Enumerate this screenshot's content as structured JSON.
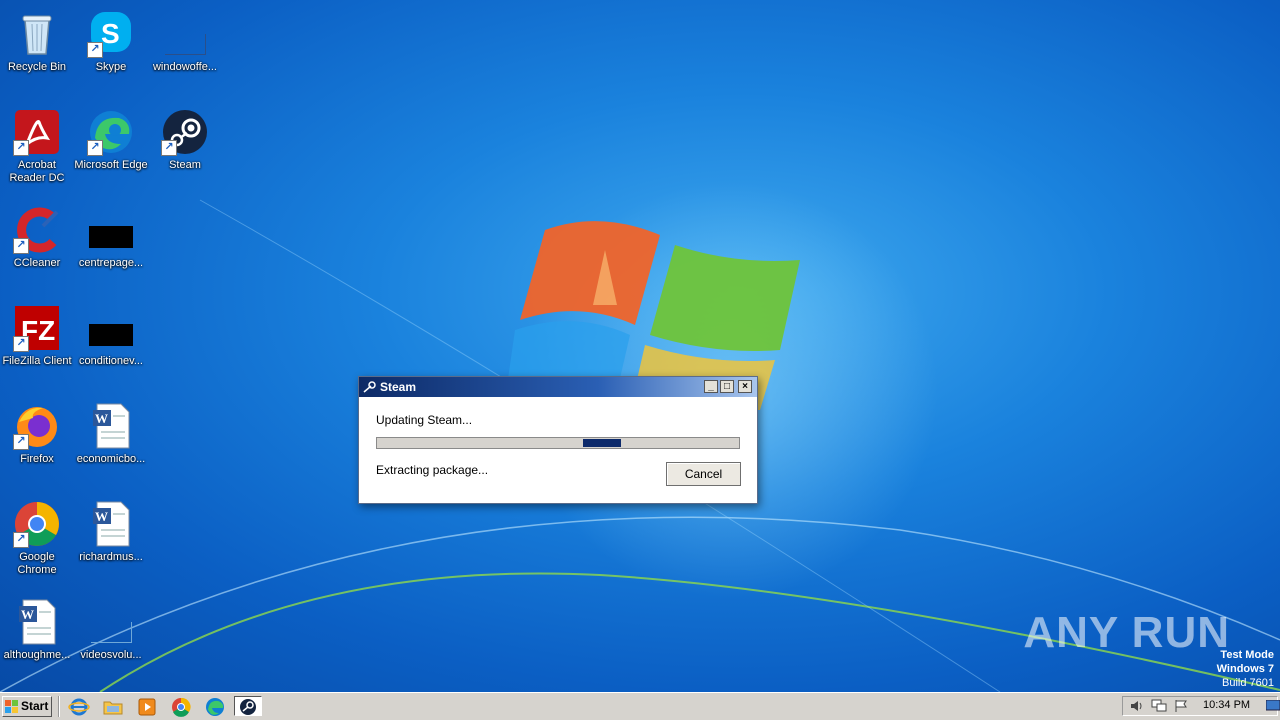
{
  "desktop": {
    "icons": [
      {
        "label": "Recycle Bin"
      },
      {
        "label": "Skype"
      },
      {
        "label": "windowoffe..."
      },
      {
        "label": "Acrobat Reader DC"
      },
      {
        "label": "Microsoft Edge"
      },
      {
        "label": "Steam"
      },
      {
        "label": "CCleaner"
      },
      {
        "label": "centrepage..."
      },
      {
        "label": "FileZilla Client"
      },
      {
        "label": "conditionev..."
      },
      {
        "label": "Firefox"
      },
      {
        "label": "economicbo..."
      },
      {
        "label": "Google Chrome"
      },
      {
        "label": "richardmus..."
      },
      {
        "label": "althoughme..."
      },
      {
        "label": "videosvolu..."
      }
    ]
  },
  "dialog": {
    "title": "Steam",
    "minimize_label": "_",
    "maximize_label": "□",
    "close_label": "×",
    "status_text": "Updating Steam...",
    "sub_status_text": "Extracting package...",
    "cancel_label": "Cancel"
  },
  "watermark": {
    "brand": "ANY RUN",
    "line1": "Test Mode",
    "line2": "Windows 7",
    "line3": "Build 7601"
  },
  "taskbar": {
    "start_label": "Start",
    "clock": "10:34 PM"
  },
  "colors": {
    "desktop_blue": "#1a82dd",
    "progress_fill": "#0d2a6b",
    "titlebar_dark": "#0d2a66"
  },
  "icons": {
    "recycle_bin": "recycle-bin-icon",
    "skype": "skype-icon",
    "acrobat": "acrobat-icon",
    "edge": "edge-icon",
    "steam": "steam-icon",
    "ccleaner": "ccleaner-icon",
    "filezilla": "filezilla-icon",
    "firefox": "firefox-icon",
    "chrome": "chrome-icon",
    "word": "word-document-icon"
  }
}
